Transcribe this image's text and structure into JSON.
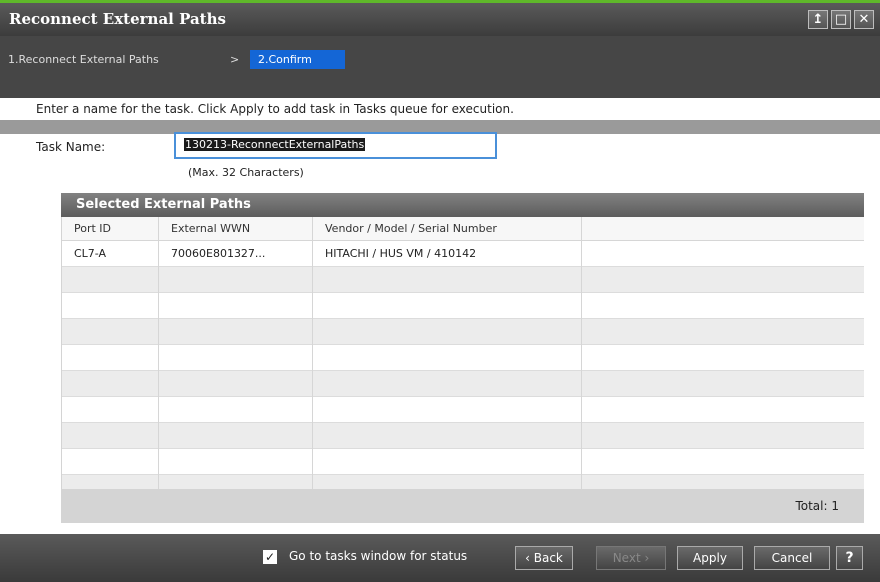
{
  "window": {
    "title": "Reconnect External Paths",
    "controls": [
      "pin-icon",
      "maximize-icon",
      "close-icon"
    ],
    "controls_glyphs": [
      "↥",
      "□",
      "✕"
    ]
  },
  "breadcrumb": {
    "step1": "1.Reconnect External Paths",
    "separator": ">",
    "step2": "2.Confirm"
  },
  "instruction": "Enter a name for the task. Click Apply to add task in Tasks queue for execution.",
  "task": {
    "label": "Task Name:",
    "value": "130213-ReconnectExternalPaths",
    "note": "(Max. 32 Characters)"
  },
  "table": {
    "title": "Selected External Paths",
    "columns": [
      "Port ID",
      "External WWN",
      "Vendor / Model / Serial Number",
      ""
    ],
    "rows": [
      [
        "CL7-A",
        "70060E801327...",
        "HITACHI / HUS VM / 410142",
        ""
      ]
    ],
    "total_label": "Total:",
    "total_value": "1"
  },
  "footer": {
    "checkbox_label": "Go to tasks window for status",
    "checkbox_checked": true,
    "back": "Back",
    "next": "Next",
    "apply": "Apply",
    "cancel": "Cancel",
    "help": "?"
  },
  "colors": {
    "accent_green": "#5fb82a",
    "breadcrumb_active": "#1466d6",
    "input_focus": "#4a90d9"
  }
}
